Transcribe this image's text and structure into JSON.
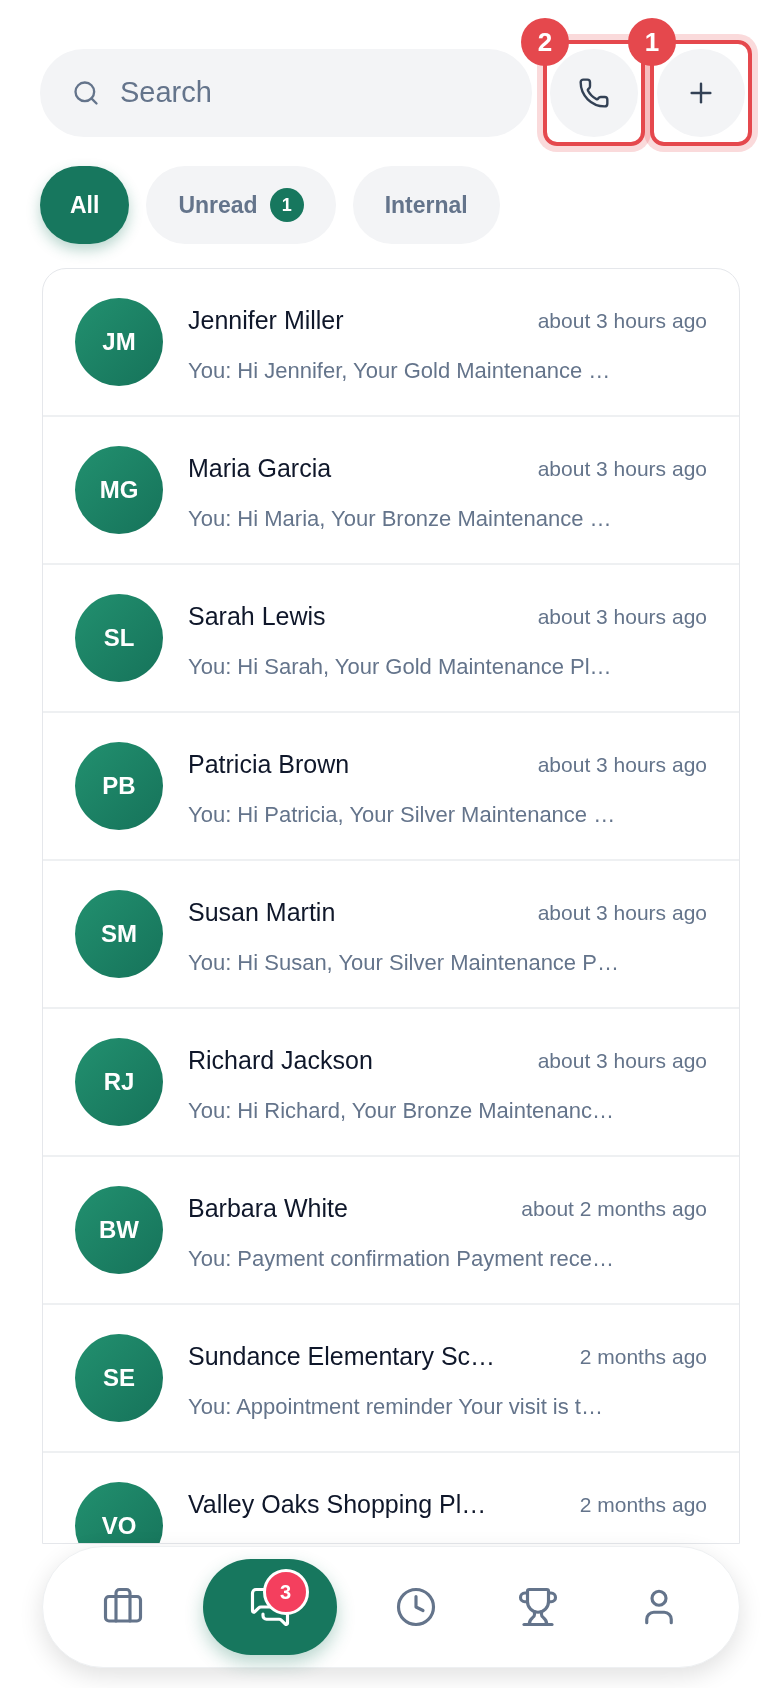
{
  "search": {
    "placeholder": "Search"
  },
  "actions": [
    {
      "kind": "phone",
      "annotation": "2"
    },
    {
      "kind": "add",
      "annotation": "1"
    }
  ],
  "filters": [
    {
      "label": "All",
      "selected": true
    },
    {
      "label": "Unread",
      "selected": false,
      "count": "1"
    },
    {
      "label": "Internal",
      "selected": false
    }
  ],
  "conversations": [
    {
      "initials": "JM",
      "name": "Jennifer Miller",
      "time": "about 3 hours ago",
      "preview": "You: Hi Jennifer, Your Gold Maintenance …"
    },
    {
      "initials": "MG",
      "name": "Maria Garcia",
      "time": "about 3 hours ago",
      "preview": "You: Hi Maria, Your Bronze Maintenance …"
    },
    {
      "initials": "SL",
      "name": "Sarah Lewis",
      "time": "about 3 hours ago",
      "preview": "You: Hi Sarah, Your Gold Maintenance Pl…"
    },
    {
      "initials": "PB",
      "name": "Patricia Brown",
      "time": "about 3 hours ago",
      "preview": "You: Hi Patricia, Your Silver Maintenance …"
    },
    {
      "initials": "SM",
      "name": "Susan Martin",
      "time": "about 3 hours ago",
      "preview": "You: Hi Susan, Your Silver Maintenance P…"
    },
    {
      "initials": "RJ",
      "name": "Richard Jackson",
      "time": "about 3 hours ago",
      "preview": "You: Hi Richard, Your Bronze Maintenanc…"
    },
    {
      "initials": "BW",
      "name": "Barbara White",
      "time": "about 2 months ago",
      "preview": "You: Payment confirmation Payment rece…"
    },
    {
      "initials": "SE",
      "name": "Sundance Elementary Sc…",
      "time": "2 months ago",
      "preview": "You: Appointment reminder Your visit is t…"
    },
    {
      "initials": "VO",
      "name": "Valley Oaks Shopping Pl…",
      "time": "2 months ago"
    }
  ],
  "nav": [
    {
      "kind": "briefcase",
      "selected": false
    },
    {
      "kind": "chat",
      "selected": true,
      "badge": "3"
    },
    {
      "kind": "clock",
      "selected": false
    },
    {
      "kind": "trophy",
      "selected": false
    },
    {
      "kind": "user",
      "selected": false
    }
  ]
}
